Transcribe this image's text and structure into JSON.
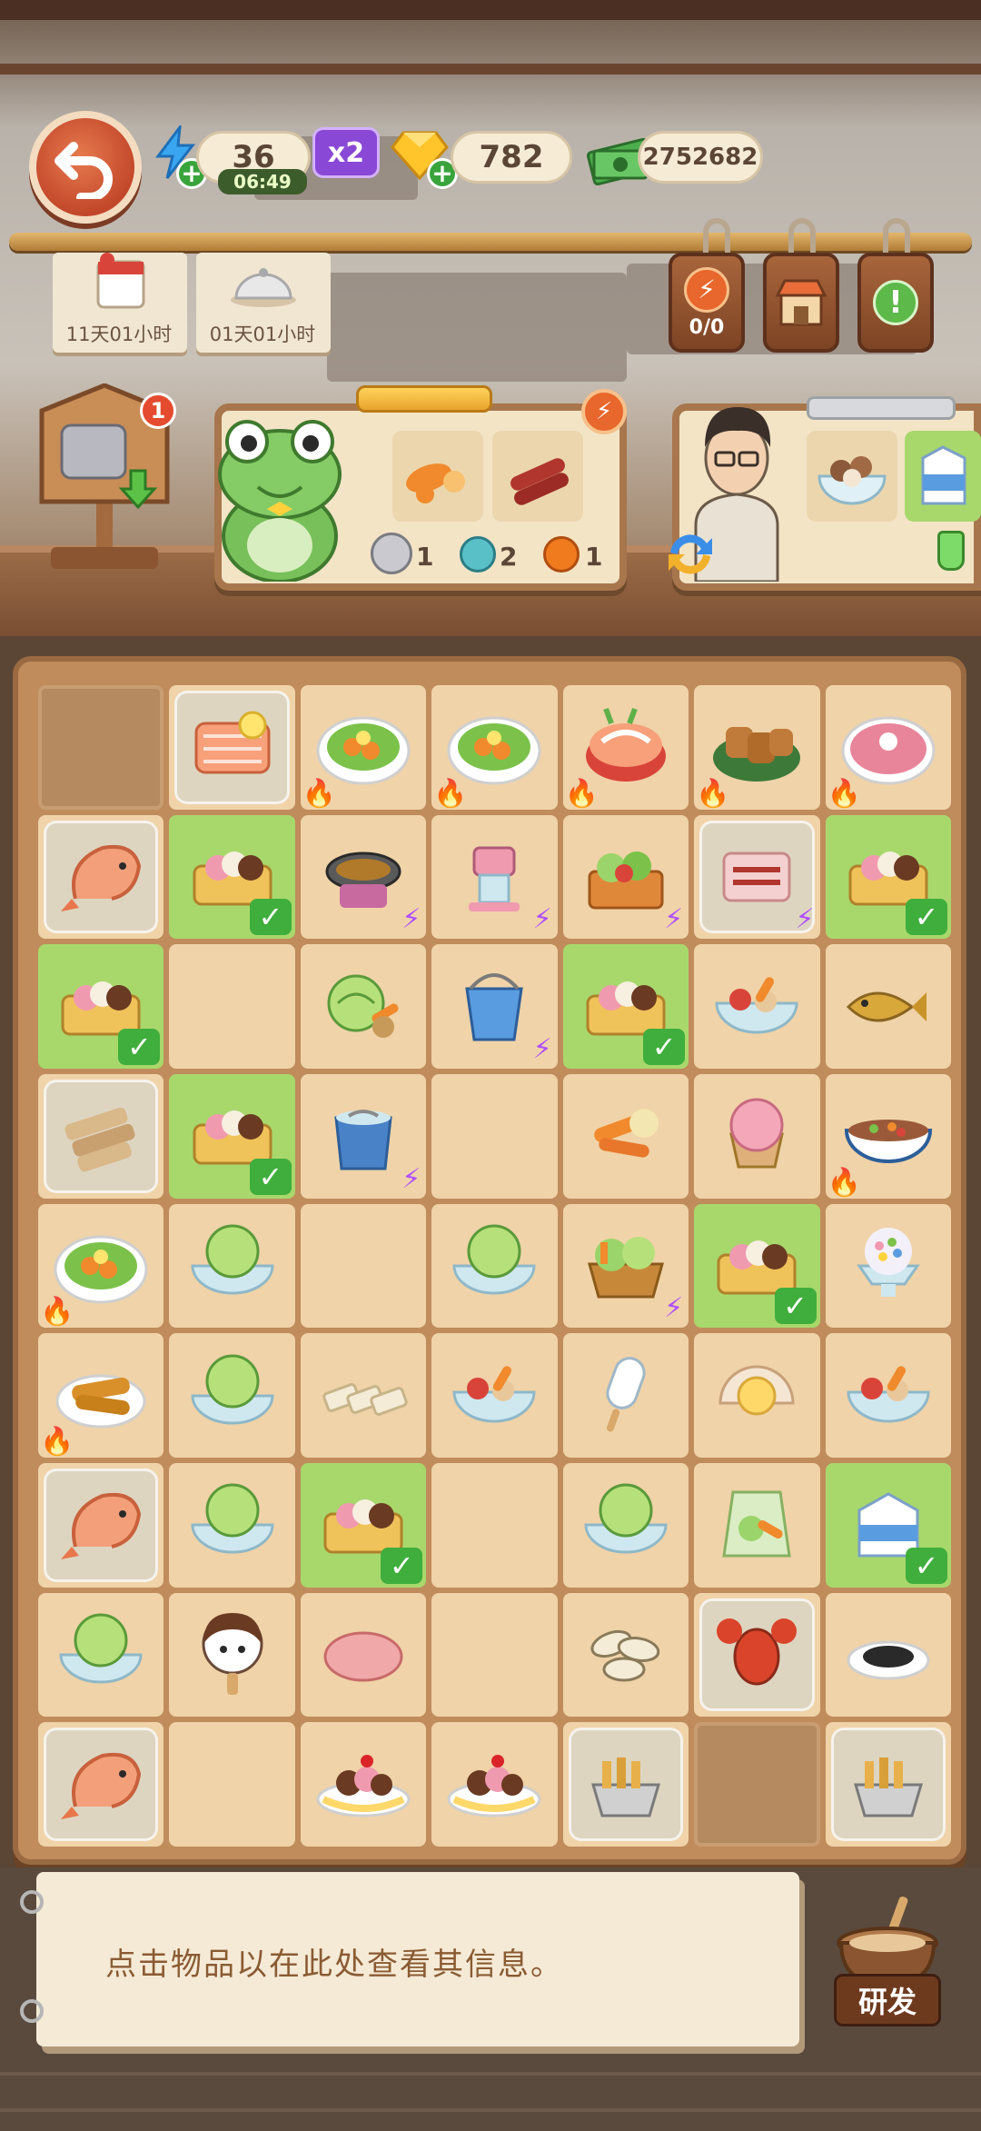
{
  "hud": {
    "energy": "36",
    "energy_timer": "06:49",
    "multiplier": "x2",
    "gems": "782",
    "cash": "2752682"
  },
  "notes": [
    {
      "label": "11天01小时"
    },
    {
      "label": "01天01小时"
    }
  ],
  "tags": {
    "progress": "0/0"
  },
  "sign_badge": "1",
  "order1": {
    "counts": [
      "1",
      "2",
      "1"
    ]
  },
  "board_rows": [
    [
      "empty-wood",
      "salmon-locked",
      "salad-fire",
      "salad-fire",
      "sashimi-fire",
      "bread-fire",
      "meat-platter-fire"
    ],
    [
      "shrimp-locked",
      "icecream-box-check",
      "grill-bolt",
      "shaved-ice-machine-bolt",
      "veg-crate-bolt",
      "bacon-locked-bolt",
      "icecream-box-check"
    ],
    [
      "icecream-box-check",
      "blank",
      "cabbage",
      "bucket-bolt",
      "icecream-box-check",
      "veg-bowl",
      "fish"
    ],
    [
      "bread-sticks-locked",
      "icecream-box-check",
      "fish-bucket-bolt",
      "blank",
      "carrots",
      "pink-scoop",
      "bean-bowl-fire"
    ],
    [
      "salad-fire",
      "cabbage-bowl",
      "blank",
      "cabbage-bowl",
      "veg-basket-bolt",
      "icecream-box-check",
      "rainbow-ice"
    ],
    [
      "fried-fish-fire",
      "cabbage-bowl",
      "tofu-sticks",
      "veg-bowl",
      "popsicle",
      "scallop",
      "veg-bowl"
    ],
    [
      "shrimp-locked",
      "cabbage-bowl",
      "icecream-box-check",
      "blank",
      "cabbage-bowl",
      "veg-bag",
      "milk-carton-check"
    ],
    [
      "cabbage-bowl",
      "face-popsicle",
      "ham",
      "blank",
      "seeds",
      "lobster-locked",
      "pepper-plate"
    ],
    [
      "shrimp-locked",
      "blank",
      "banana-split",
      "banana-split",
      "fries-basket-locked",
      "empty-wood",
      "fries-basket-locked"
    ]
  ],
  "info": {
    "text": "点击物品以在此处查看其信息。"
  },
  "research": {
    "label": "研发"
  }
}
